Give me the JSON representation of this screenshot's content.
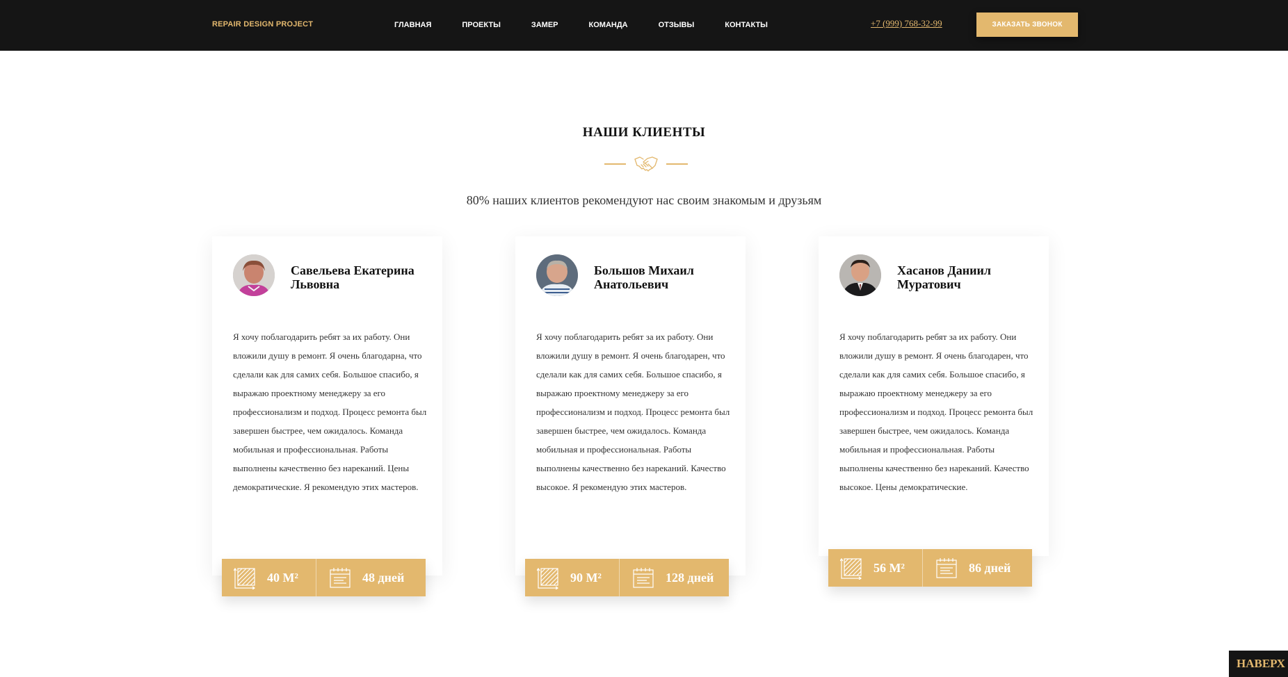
{
  "header": {
    "logo": "REPAIR DESIGN PROJECT",
    "nav": [
      "ГЛАВНАЯ",
      "ПРОЕКТЫ",
      "ЗАМЕР",
      "КОМАНДА",
      "ОТЗЫВЫ",
      "КОНТАКТЫ"
    ],
    "phone": "+7 (999) 768-32-99",
    "call_button": "ЗАКАЗАТЬ ЗВОНОК"
  },
  "section": {
    "title": "НАШИ КЛИЕНТЫ",
    "divider_icon": "handshake-icon",
    "subtitle": "80% наших клиентов рекомендуют нас своим знакомым и друзьям"
  },
  "reviews": [
    {
      "name": "Савельева Екатерина Львовна",
      "text": "Я хочу поблагодарить ребят за их работу. Они вложили душу в ремонт. Я очень благодарна, что сделали как для самих себя. Большое спасибо, я выражаю проектному менеджеру за его профессионализм и подход. Процесс ремонта был завершен быстрее, чем ожидалось. Команда мобильная и профессиональная. Работы выполнены качественно без нареканий. Цены демократические. Я рекомендую этих мастеров.",
      "area": "40 М²",
      "days": "48 дней"
    },
    {
      "name": "Большов Михаил Анатольевич",
      "text": "Я хочу поблагодарить ребят за их работу. Они вложили душу в ремонт. Я очень благодарен, что сделали как для самих себя. Большое спасибо, я выражаю проектному менеджеру за его профессионализм и подход. Процесс ремонта был завершен быстрее, чем ожидалось. Команда мобильная и профессиональная. Работы выполнены качественно без нареканий. Качество высокое. Я рекомендую этих мастеров.",
      "area": "90 М²",
      "days": "128 дней"
    },
    {
      "name": "Хасанов Даниил Муратович",
      "text": "Я хочу поблагодарить ребят за их работу. Они вложили душу в ремонт. Я очень благодарен, что сделали как для самих себя. Большое спасибо, я выражаю проектному менеджеру за его профессионализм и подход. Процесс ремонта был завершен быстрее, чем ожидалось. Команда мобильная и профессиональная. Работы выполнены качественно без нареканий. Качество высокое. Цены демократические.",
      "area": "56 М²",
      "days": "86 дней"
    }
  ],
  "to_top": "НАВЕРХ",
  "colors": {
    "accent": "#e3b86e",
    "header_bg": "#151515"
  }
}
